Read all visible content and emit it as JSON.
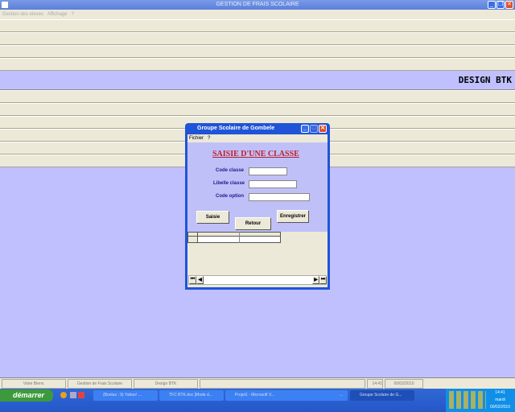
{
  "window": {
    "title": "GESTION DE FRAIS SCOLAIRE",
    "menu": [
      "Gestion des eleves",
      "Affichage",
      "?"
    ]
  },
  "banner": "DESIGN BTK",
  "dialog": {
    "title": "Groupe Scolaire de Gombele",
    "menu": [
      "Fichier",
      "?"
    ],
    "heading": "SAISIE D'UNE CLASSE",
    "fields": [
      {
        "label": "Code classe",
        "value": ""
      },
      {
        "label": "Libelle classe",
        "value": ""
      },
      {
        "label": "Code option",
        "value": ""
      }
    ],
    "buttons": {
      "saisie": "Saisie",
      "retour": "Retour",
      "enregistrer": "Enregistrer"
    }
  },
  "statusbar": [
    "Votre Bienv.",
    "Gestion de Frais Scolaire",
    "Design BTK",
    "",
    "14:41",
    "00/02/2010"
  ],
  "taskbar": {
    "start": "démarrer",
    "tasks": [
      "(Bonlus : 9) Yahoo! ...",
      "TFC BTK.doc [Mode d...",
      "Projet1 - Microsoft V...",
      "...",
      "Groupe Scolaire de G..."
    ],
    "clock": "14:41",
    "day": "mardi",
    "date": "00/02/2010"
  }
}
